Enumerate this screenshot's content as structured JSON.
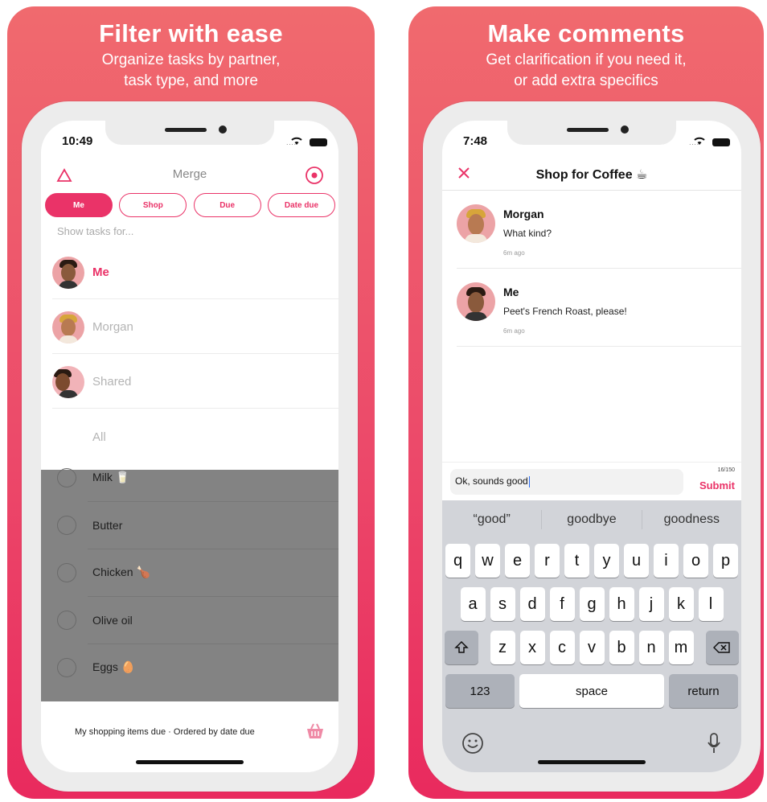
{
  "panel1": {
    "headline": "Filter with ease",
    "sub_line1": "Organize tasks by partner,",
    "sub_line2": "task type, and more",
    "phone": {
      "time": "10:49",
      "title": "Merge",
      "chips": [
        "Me",
        "Shop",
        "Due",
        "Date due"
      ],
      "show_label": "Show tasks for...",
      "filters": [
        {
          "name": "Me"
        },
        {
          "name": "Morgan"
        },
        {
          "name": "Shared"
        },
        {
          "name": "All"
        }
      ],
      "tasks": [
        "Milk 🥛",
        "Butter",
        "Chicken 🍗",
        "Olive oil",
        "Eggs 🥚"
      ],
      "footer": "My shopping items due · Ordered by date due"
    }
  },
  "panel2": {
    "headline": "Make comments",
    "sub_line1": "Get clarification if you need it,",
    "sub_line2": "or add extra specifics",
    "phone": {
      "time": "7:48",
      "title": "Shop for Coffee ☕",
      "comments": [
        {
          "name": "Morgan",
          "text": "What kind?",
          "time": "6m ago"
        },
        {
          "name": "Me",
          "text": "Peet's French Roast, please!",
          "time": "6m ago"
        }
      ],
      "input_value": "Ok, sounds good",
      "char_count": "16/150",
      "submit": "Submit",
      "suggestions": [
        "“good”",
        "goodbye",
        "goodness"
      ],
      "keys_row1": [
        "q",
        "w",
        "e",
        "r",
        "t",
        "y",
        "u",
        "i",
        "o",
        "p"
      ],
      "keys_row2": [
        "a",
        "s",
        "d",
        "f",
        "g",
        "h",
        "j",
        "k",
        "l"
      ],
      "keys_row3": [
        "z",
        "x",
        "c",
        "v",
        "b",
        "n",
        "m"
      ],
      "key_123": "123",
      "key_space": "space",
      "key_return": "return"
    }
  },
  "colors": {
    "accent": "#ea3368",
    "panel_top": "#f06a6e",
    "panel_bottom": "#e92a5e"
  }
}
